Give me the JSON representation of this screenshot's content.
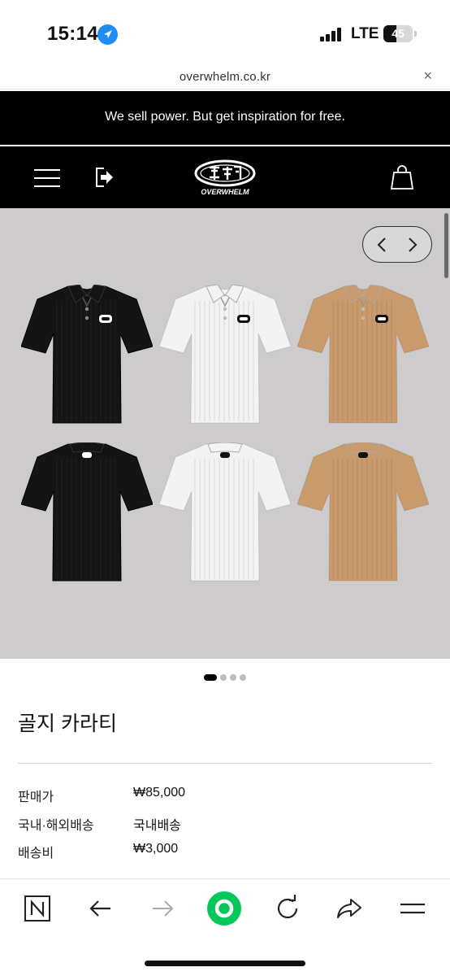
{
  "status_bar": {
    "time": "15:14",
    "location_icon": "location-arrow-icon",
    "network": "LTE",
    "battery_level": "45",
    "battery_fraction": 0.45
  },
  "browser": {
    "url": "overwhelm.co.kr",
    "close_symbol": "×"
  },
  "site": {
    "announcement": "We sell power. But get inspiration for free.",
    "logo_name": "OVERWHELM",
    "menu_icon": "hamburger-menu-icon",
    "login_icon": "login-arrow-icon",
    "cart_icon": "shopping-bag-icon"
  },
  "product": {
    "name": "골지 카라티",
    "image_count": 4,
    "active_image": 1,
    "shirt_colors": [
      "#141414",
      "#f3f3f3",
      "#c99a6b"
    ],
    "background_color": "#cdcbcc",
    "details": [
      {
        "label": "판매가",
        "value": "₩85,000"
      },
      {
        "label": "국내·해외배송",
        "value": "국내배송"
      },
      {
        "label": "배송비",
        "value": "₩3,000"
      }
    ]
  },
  "toolbar": {
    "icons": [
      "naver-n-icon",
      "back-arrow-icon",
      "forward-arrow-icon",
      "naver-green-button-icon",
      "refresh-icon",
      "share-icon",
      "menu-icon"
    ],
    "accent": "#03c75a"
  }
}
